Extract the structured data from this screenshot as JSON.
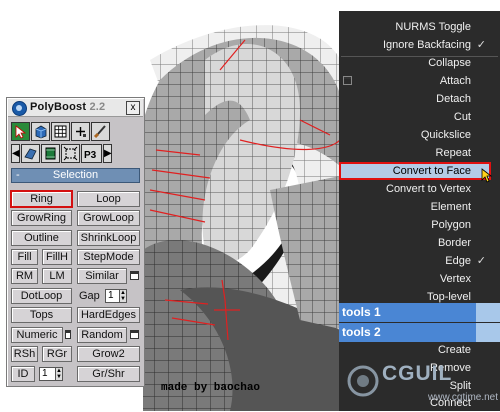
{
  "panel": {
    "title": "PolyBoost",
    "version": "2.2",
    "close": "x",
    "selection_header": "Selection",
    "selection_toggle": "-",
    "buttons": {
      "ring": "Ring",
      "loop": "Loop",
      "growring": "GrowRing",
      "growloop": "GrowLoop",
      "outline": "Outline",
      "shrinkloop": "ShrinkLoop",
      "fill": "Fill",
      "fillh": "FillH",
      "stepmode": "StepMode",
      "rm": "RM",
      "lm": "LM",
      "similar": "Similar",
      "dotloop": "DotLoop",
      "gap_label": "Gap",
      "gap_value": "1",
      "tops": "Tops",
      "hardedges": "HardEdges",
      "numeric": "Numeric",
      "random": "Random",
      "rsh": "RSh",
      "rgr": "RGr",
      "grow2": "Grow2",
      "id": "ID",
      "id_value": "1",
      "grshr": "Gr/Shr"
    },
    "toolbar2_text": "P3"
  },
  "quad_menu": {
    "items": [
      {
        "label": "NURMS Toggle"
      },
      {
        "label": "Ignore Backfacing",
        "checked": "✓"
      },
      {
        "label": "Collapse"
      },
      {
        "label": "Attach"
      },
      {
        "label": "Detach"
      },
      {
        "label": "Cut"
      },
      {
        "label": "Quickslice"
      },
      {
        "label": "Repeat"
      },
      {
        "label": "Convert to Face"
      },
      {
        "label": "Convert to Vertex"
      },
      {
        "label": "Element"
      },
      {
        "label": "Polygon"
      },
      {
        "label": "Border"
      },
      {
        "label": "Edge",
        "checked": "✓"
      },
      {
        "label": "Vertex"
      },
      {
        "label": "Top-level"
      },
      {
        "label": "Create"
      },
      {
        "label": "Remove"
      },
      {
        "label": "Split"
      },
      {
        "label": "Connect"
      }
    ],
    "tools1": "tools 1",
    "tools2": "tools 2"
  },
  "credit": "made by baochao",
  "watermark": {
    "brand": "CGUIL",
    "site": "www.cgtime.net"
  },
  "colors": {
    "panel_bg": "#c6c3c6",
    "menu_bg": "#2b2b2b",
    "menu_highlight": "#b4cbe6",
    "tools_bar": "#4a86d4",
    "red_outline": "#d41010",
    "selection_bar": "#6f8fb4"
  }
}
